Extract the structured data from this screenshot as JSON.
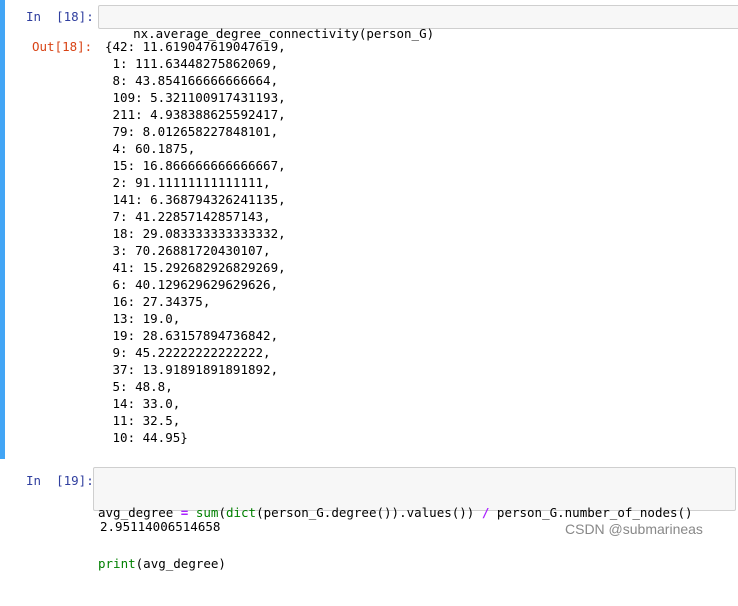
{
  "cells": {
    "cell18": {
      "in_prompt": "In  [18]:",
      "out_prompt": "Out[18]:",
      "code": "nx.average_degree_connectivity(person_G)",
      "output_lines": [
        "{42: 11.619047619047619,",
        " 1: 111.63448275862069,",
        " 8: 43.854166666666664,",
        " 109: 5.321100917431193,",
        " 211: 4.938388625592417,",
        " 79: 8.012658227848101,",
        " 4: 60.1875,",
        " 15: 16.866666666666667,",
        " 2: 91.11111111111111,",
        " 141: 6.368794326241135,",
        " 7: 41.22857142857143,",
        " 18: 29.083333333333332,",
        " 3: 70.26881720430107,",
        " 41: 15.292682926829269,",
        " 6: 40.129629629629626,",
        " 16: 27.34375,",
        " 13: 19.0,",
        " 19: 28.63157894736842,",
        " 9: 45.22222222222222,",
        " 37: 13.91891891891892,",
        " 5: 48.8,",
        " 14: 33.0,",
        " 11: 32.5,",
        " 10: 44.95}"
      ]
    },
    "cell19": {
      "in_prompt": "In  [19]:",
      "code_line1": {
        "var": "avg_degree ",
        "eq": "=",
        "sp1": " ",
        "sum": "sum",
        "p1": "(",
        "dict": "dict",
        "rest1": "(person_G.degree()).values()) ",
        "slash": "/",
        "rest2": " person_G.number_of_nodes()"
      },
      "code_line2": {
        "print": "print",
        "rest": "(avg_degree)"
      },
      "output": "2.95114006514658"
    }
  },
  "watermark": "CSDN @submarineas",
  "colors": {
    "selected_cell_bar": "#42a5f5",
    "in_prompt": "#303f9f",
    "out_prompt": "#d84315",
    "builtin": "#008000",
    "operator": "#aa22ff"
  }
}
